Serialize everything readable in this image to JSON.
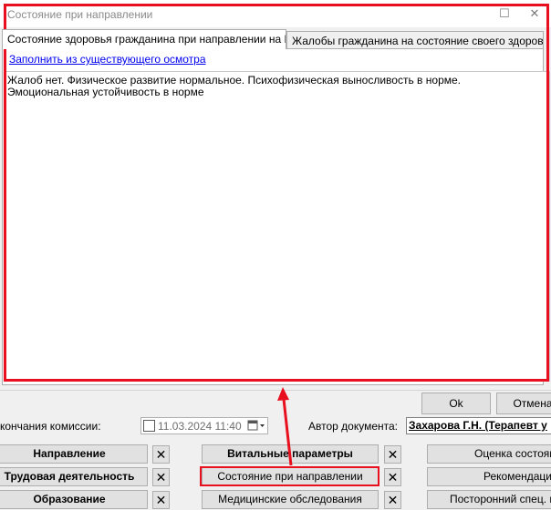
{
  "dialog": {
    "title": "Состояние при направлении",
    "window_controls": {
      "maximize": "☐",
      "close": "✕"
    },
    "tabs": [
      {
        "label": "Состояние здоровья гражданина при направлении на МСЭ",
        "active": true
      },
      {
        "label": "Жалобы гражданина на состояние своего здоровья",
        "active": false
      }
    ],
    "fill_link": "Заполнить из существующего осмотра",
    "text": "Жалоб нет. Физическое развитие нормальное. Психофизическая выносливость в норме. Эмоциональная устойчивость в норме",
    "ok_label": "Ok",
    "cancel_label": "Отмена"
  },
  "form": {
    "end_date_label": "кончания комиссии:",
    "end_date_value": "11.03.2024 11:40",
    "author_label": "Автор документа:",
    "author_value": "Захарова Г.Н. (Терапевт у",
    "buttons_left": [
      "Направление",
      "Трудовая деятельность",
      "Образование"
    ],
    "buttons_mid": [
      "Витальные параметры",
      "Состояние при направлении",
      "Медицинские обследования"
    ],
    "buttons_right": [
      "Оценка состоян",
      "Рекомендаци",
      "Посторонний спец. ме"
    ],
    "remove_glyph": "✕"
  },
  "annotations": {
    "accent_color": "#e8101e"
  }
}
